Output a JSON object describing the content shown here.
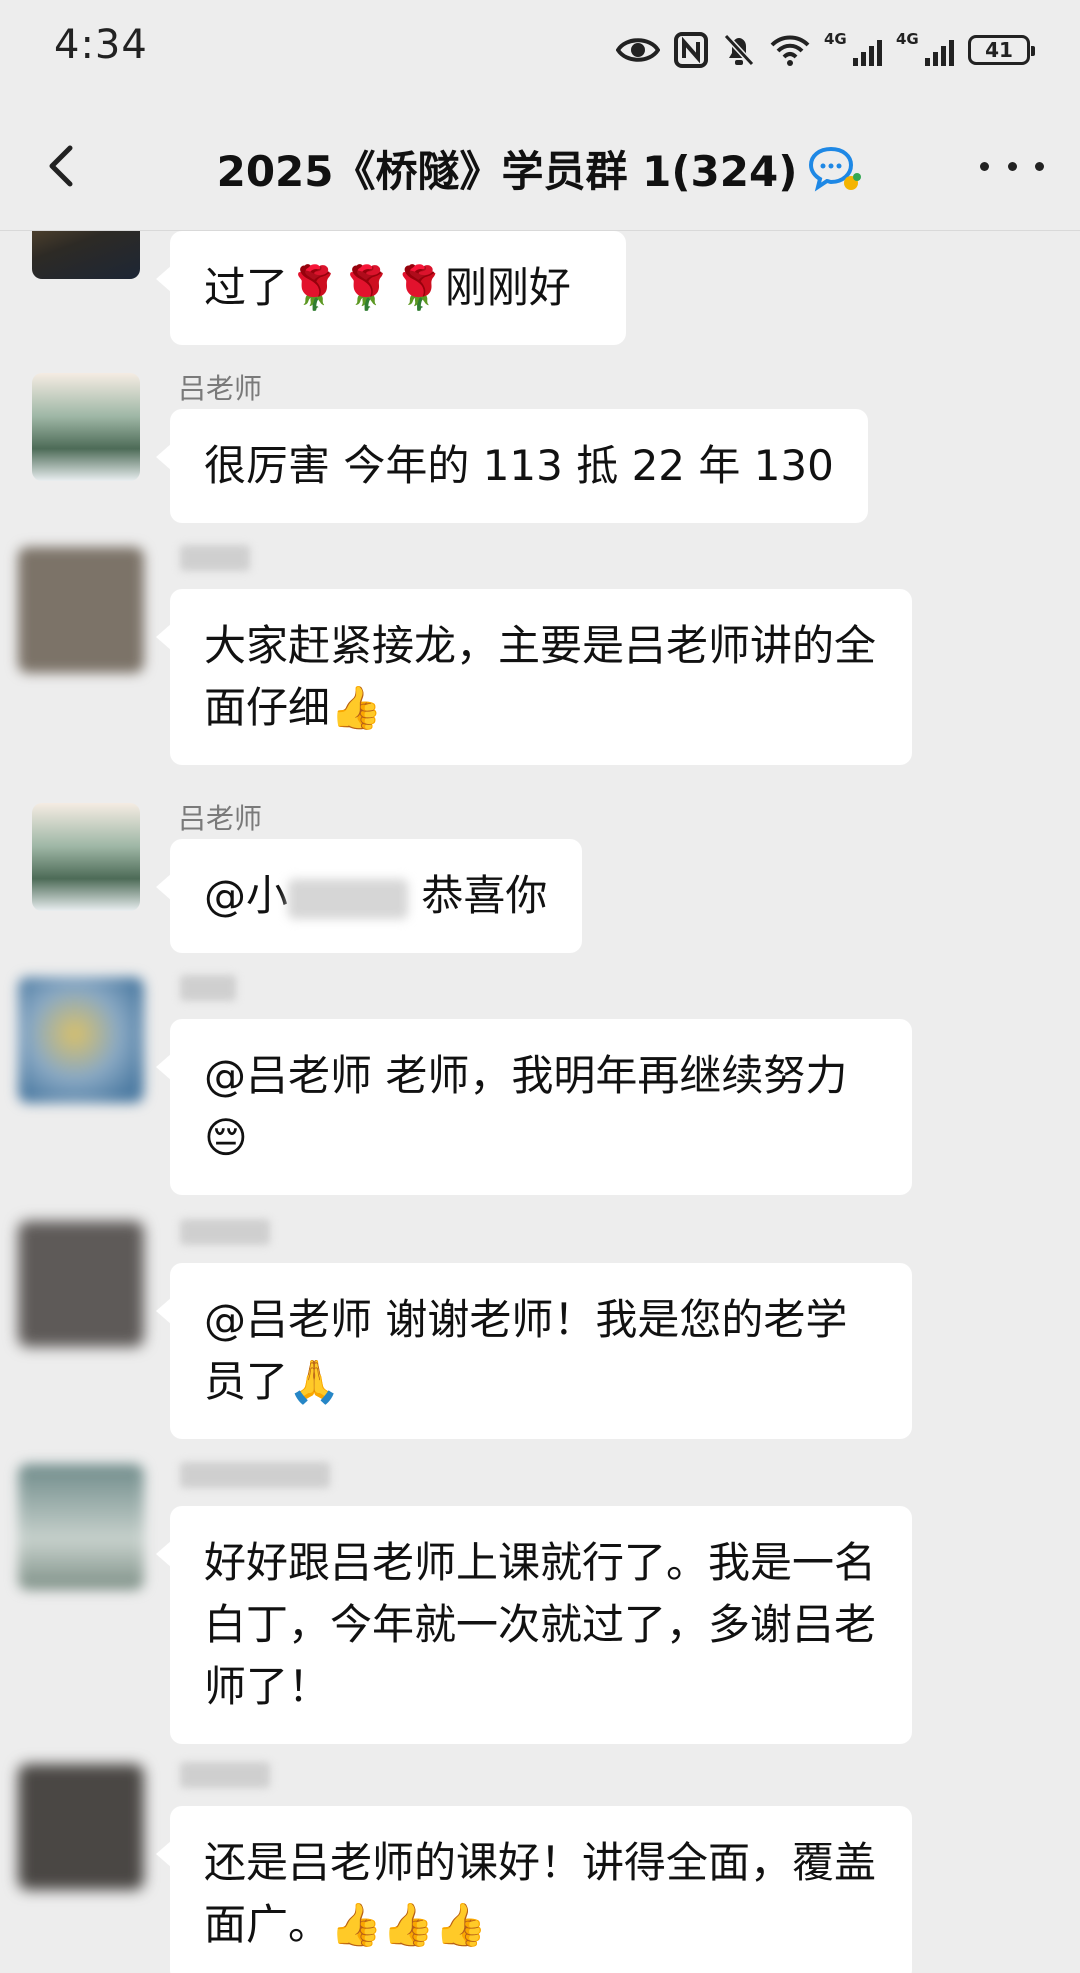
{
  "status": {
    "time": "4:34",
    "net1": "4G",
    "net2": "4G",
    "battery": "41"
  },
  "header": {
    "title": "2025《桥隧》学员群 1(324)"
  },
  "messages": [
    {
      "sender": "",
      "text": "过了🌹🌹🌹刚刚好"
    },
    {
      "sender": "吕老师",
      "text": "很厉害 今年的 113 抵 22 年 130"
    },
    {
      "sender": "",
      "text": "大家赶紧接龙，主要是吕老师讲的全面仔细👍"
    },
    {
      "sender": "吕老师",
      "text_prefix": "@小",
      "text_suffix": " 恭喜你"
    },
    {
      "sender": "",
      "text": "@吕老师  老师，我明年再继续努力😔"
    },
    {
      "sender": "",
      "text": "@吕老师  谢谢老师！我是您的老学员了🙏"
    },
    {
      "sender": "",
      "text": "好好跟吕老师上课就行了。我是一名白丁，今年就一次就过了，多谢吕老师了！"
    },
    {
      "sender": "",
      "text": "还是吕老师的课好！讲得全面，覆盖面广。👍👍👍"
    }
  ],
  "icons": {
    "back": "chevron-left-icon",
    "more": "more-dots-icon",
    "chat_badge": "chat-bubble-icon",
    "eye": "eye-icon",
    "nfc": "nfc-icon",
    "mute": "bell-off-icon",
    "wifi": "wifi-icon"
  },
  "colors": {
    "background": "#ededed",
    "bubble": "#ffffff",
    "sender": "#7a7a7a"
  }
}
